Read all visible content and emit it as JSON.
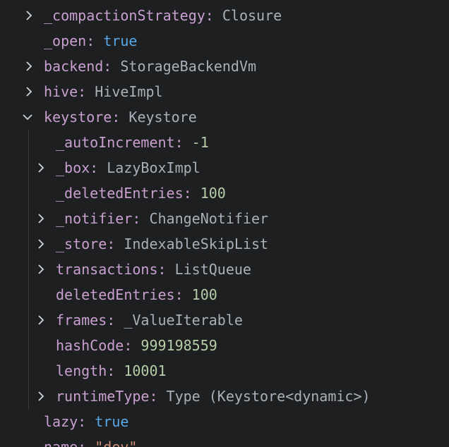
{
  "variables": {
    "rows": [
      {
        "key": "_compactionStrategy",
        "value": "Closure",
        "kind": "type",
        "expanded": false,
        "expandable": true
      },
      {
        "key": "_open",
        "value": "true",
        "kind": "bool",
        "expanded": false,
        "expandable": false
      },
      {
        "key": "backend",
        "value": "StorageBackendVm",
        "kind": "type",
        "expanded": false,
        "expandable": true
      },
      {
        "key": "hive",
        "value": "HiveImpl",
        "kind": "type",
        "expanded": false,
        "expandable": true
      },
      {
        "key": "keystore",
        "value": "Keystore",
        "kind": "type",
        "expanded": true,
        "expandable": true
      },
      {
        "key": "_autoIncrement",
        "value": "-1",
        "kind": "num",
        "expanded": false,
        "expandable": false
      },
      {
        "key": "_box",
        "value": "LazyBoxImpl",
        "kind": "type",
        "expanded": false,
        "expandable": true
      },
      {
        "key": "_deletedEntries",
        "value": "100",
        "kind": "num",
        "expanded": false,
        "expandable": false
      },
      {
        "key": "_notifier",
        "value": "ChangeNotifier",
        "kind": "type",
        "expanded": false,
        "expandable": true
      },
      {
        "key": "_store",
        "value": "IndexableSkipList",
        "kind": "type",
        "expanded": false,
        "expandable": true
      },
      {
        "key": "transactions",
        "value": "ListQueue",
        "kind": "type",
        "expanded": false,
        "expandable": true
      },
      {
        "key": "deletedEntries",
        "value": "100",
        "kind": "num",
        "expanded": false,
        "expandable": false
      },
      {
        "key": "frames",
        "value": "_ValueIterable",
        "kind": "type",
        "expanded": false,
        "expandable": true
      },
      {
        "key": "hashCode",
        "value": "999198559",
        "kind": "num",
        "expanded": false,
        "expandable": false
      },
      {
        "key": "length",
        "value": "10001",
        "kind": "num",
        "expanded": false,
        "expandable": false
      },
      {
        "key": "runtimeType",
        "value": "Type (Keystore<dynamic>)",
        "kind": "type",
        "expanded": false,
        "expandable": true
      },
      {
        "key": "lazy",
        "value": "true",
        "kind": "bool",
        "expanded": false,
        "expandable": false
      },
      {
        "key": "name",
        "value": "\"dev\"",
        "kind": "str",
        "expanded": false,
        "expandable": false
      }
    ]
  },
  "colors": {
    "background": "#1e1f21",
    "key": "#c8a0cf",
    "type": "#a9b0b9",
    "bool": "#5aa7e6",
    "number": "#b5cea8",
    "string": "#ce9178",
    "chevron": "#cfd2d6"
  },
  "icons": {
    "collapsed": "chevron-right-icon",
    "expanded": "chevron-down-icon"
  }
}
